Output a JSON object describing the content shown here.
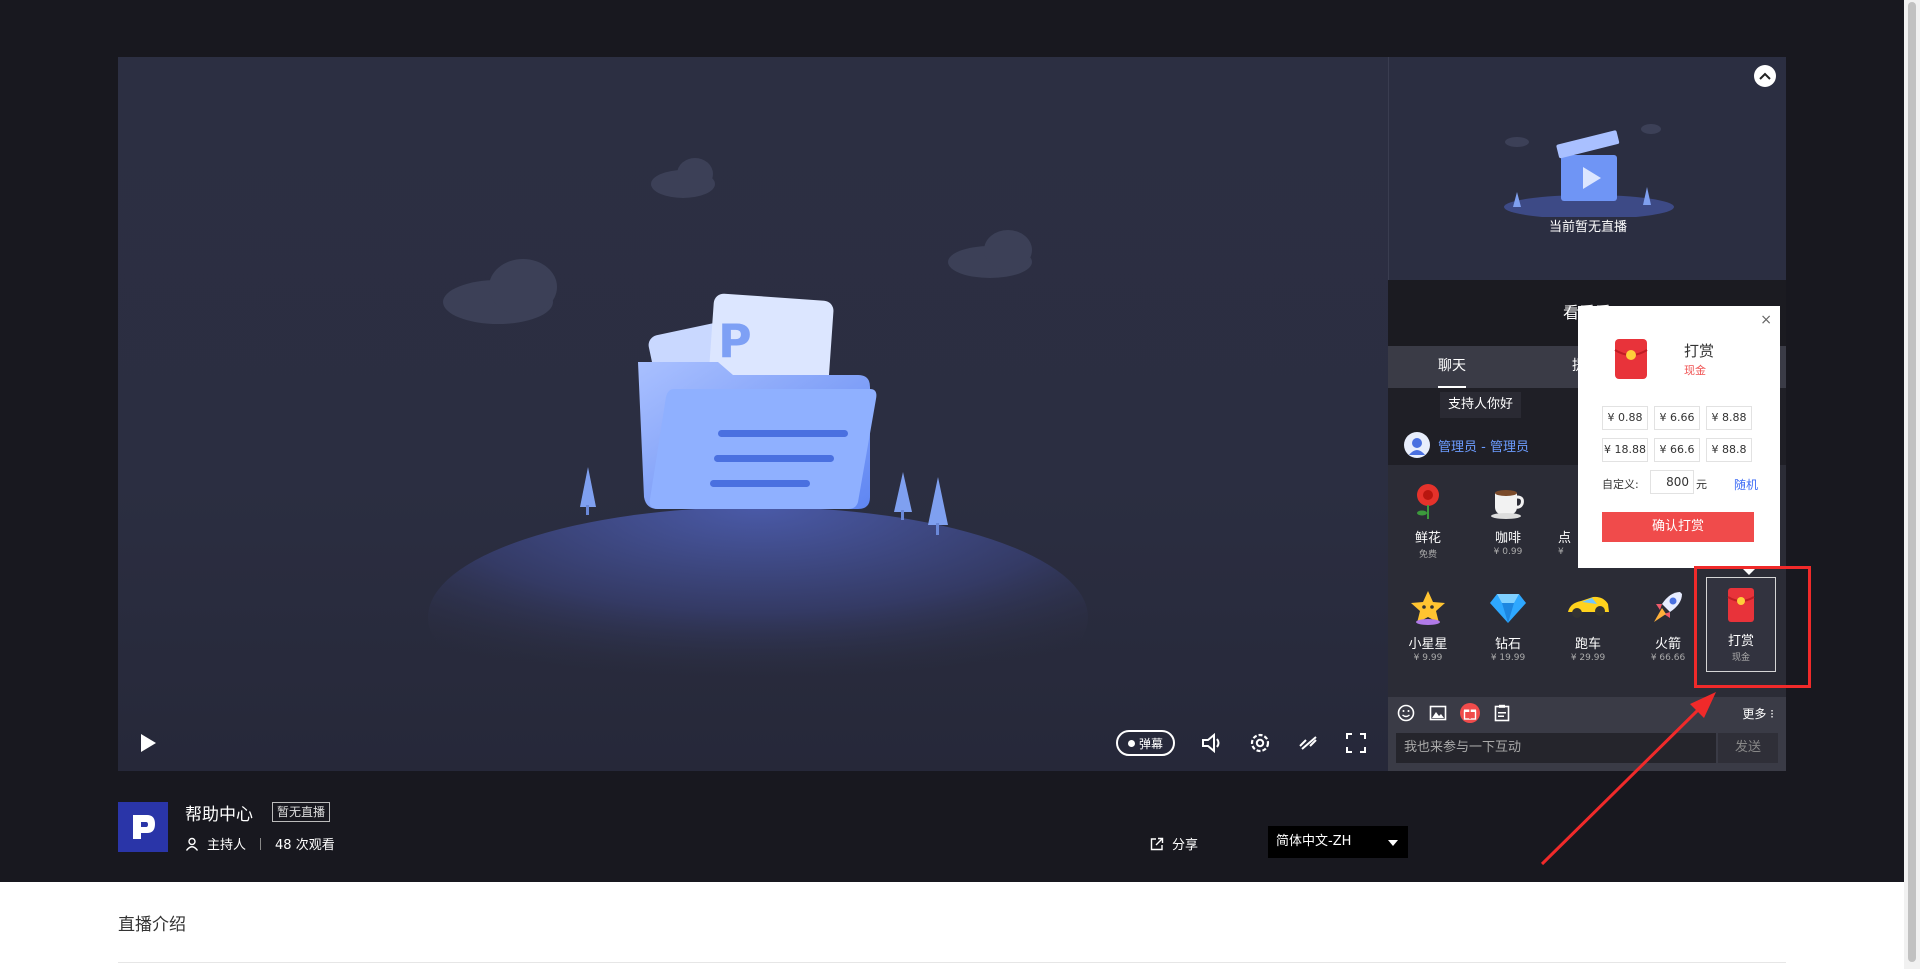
{
  "player": {
    "danmu_label": "弹幕"
  },
  "side": {
    "no_live_text": "当前暂无直播",
    "title": "看看看",
    "tabs": [
      {
        "label": "聊天"
      },
      {
        "label": "提"
      }
    ],
    "chat": {
      "bubble": "支持人你好",
      "admin_name": "管理员 - 管理员"
    },
    "gifts": [
      {
        "name": "鲜花",
        "price": "免费"
      },
      {
        "name": "咖啡",
        "price": "¥ 0.99"
      },
      {
        "name": "点",
        "price": "¥"
      },
      {
        "name": "小星星",
        "price": "¥ 9.99"
      },
      {
        "name": "钻石",
        "price": "¥ 19.99"
      },
      {
        "name": "跑车",
        "price": "¥ 29.99"
      },
      {
        "name": "火箭",
        "price": "¥ 66.66"
      },
      {
        "name": "打赏",
        "price": "现金"
      }
    ],
    "toolbar": {
      "more": "更多"
    },
    "input": {
      "placeholder": "我也来参与一下互动",
      "send": "发送"
    }
  },
  "popup": {
    "title": "打赏",
    "subtitle": "现金",
    "close": "×",
    "amounts": [
      "¥ 0.88",
      "¥ 6.66",
      "¥ 8.88",
      "¥ 18.88",
      "¥ 66.6",
      "¥ 88.8"
    ],
    "custom_label": "自定义:",
    "custom_value": "800",
    "unit": "元",
    "random": "随机",
    "confirm": "确认打赏"
  },
  "info": {
    "title": "帮助中心",
    "status": "暂无直播",
    "host": "主持人",
    "views": "48 次观看",
    "share": "分享",
    "language": "简体中文-ZH"
  },
  "intro": {
    "title": "直播介绍"
  },
  "colors": {
    "accent_red": "#f04b4b",
    "link_blue": "#3d6bf5",
    "highlight": "#f02a2a"
  }
}
